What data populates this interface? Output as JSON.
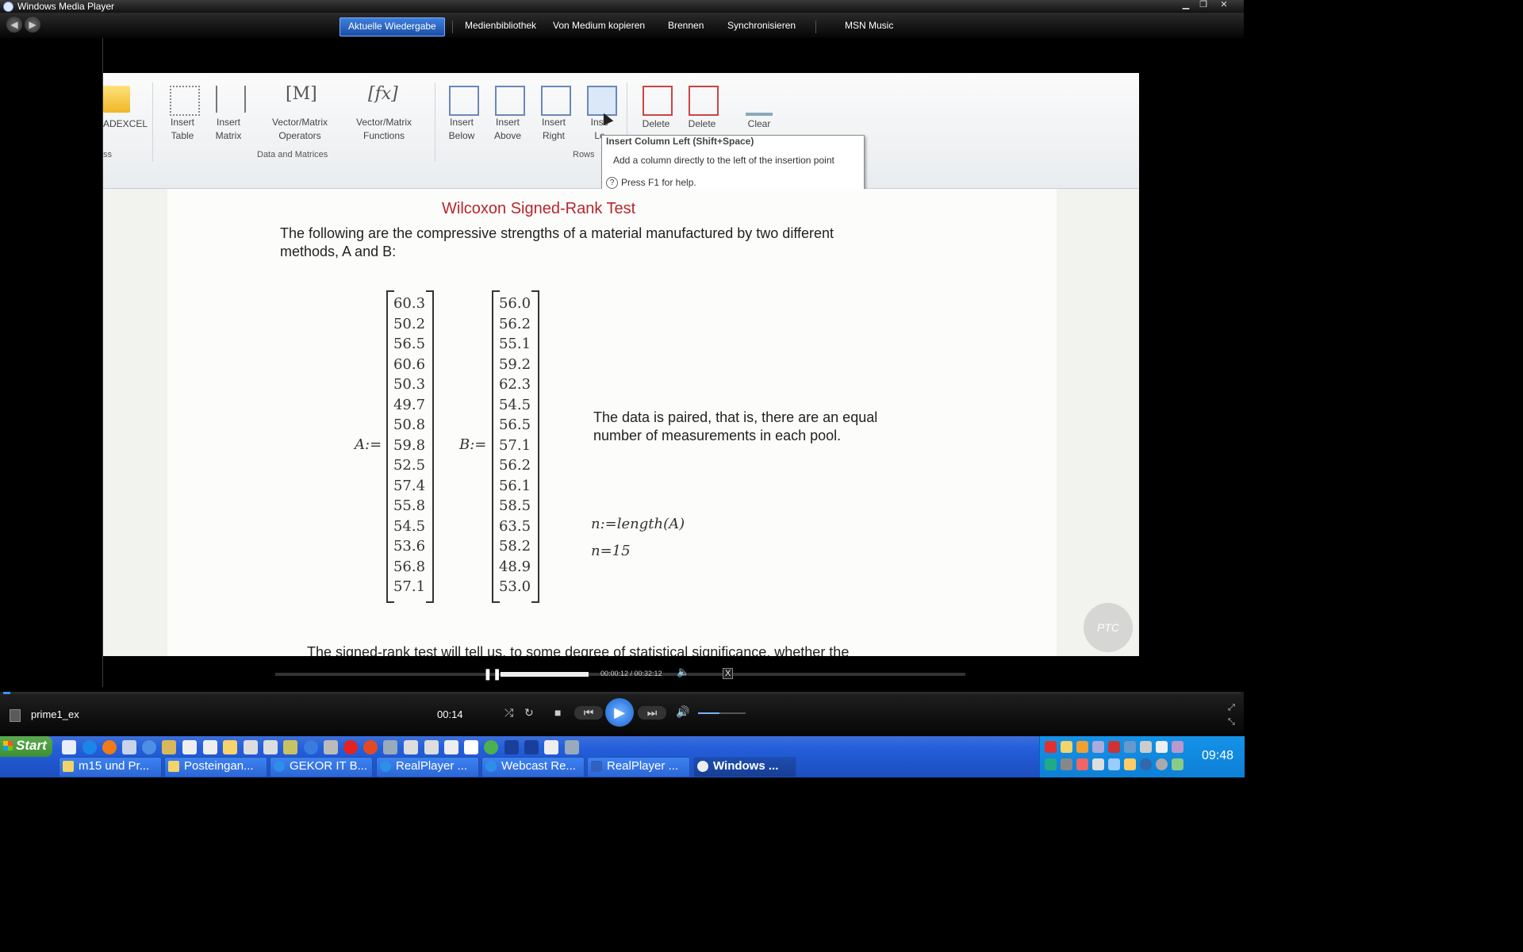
{
  "window": {
    "title": "Windows Media Player"
  },
  "nav": {
    "back": "◀",
    "forward": "▶",
    "tabs": [
      "Aktuelle Wiedergabe",
      "Medienbibliothek",
      "Von Medium kopieren",
      "Brennen",
      "Synchronisieren",
      "MSN Music"
    ]
  },
  "ribbon": {
    "addexcel": "ADEXCEL",
    "insert_table": [
      "Insert",
      "Table"
    ],
    "insert_matrix": [
      "Insert",
      "Matrix"
    ],
    "vm_operators": [
      "Vector/Matrix",
      "Operators"
    ],
    "vm_functions": [
      "Vector/Matrix",
      "Functions"
    ],
    "insert_below": [
      "Insert",
      "Below"
    ],
    "insert_above": [
      "Insert",
      "Above"
    ],
    "insert_right": [
      "Insert",
      "Right"
    ],
    "insert_left": [
      "Inse",
      "Le"
    ],
    "delete1": "Delete",
    "delete2": "Delete",
    "clear": "Clear",
    "group_left": "ss",
    "group_data": "Data and Matrices",
    "group_rows": "Rows"
  },
  "tooltip": {
    "title": "Insert Column Left (Shift+Space)",
    "desc": "Add a column directly to the left of the insertion point",
    "help": "Press F1 for help."
  },
  "doc": {
    "heading": "Wilcoxon Signed-Rank Test",
    "intro_line1": "The following are the compressive strengths of a material manufactured by two different",
    "intro_line2": "methods, A and B:",
    "label_a": "A:=",
    "label_b": "B:=",
    "values_a": [
      "60.3",
      "50.2",
      "56.5",
      "60.6",
      "50.3",
      "49.7",
      "50.8",
      "59.8",
      "52.5",
      "57.4",
      "55.8",
      "54.5",
      "53.6",
      "56.8",
      "57.1"
    ],
    "values_b": [
      "56.0",
      "56.2",
      "55.1",
      "59.2",
      "62.3",
      "54.5",
      "56.5",
      "57.1",
      "56.2",
      "56.1",
      "58.5",
      "63.5",
      "58.2",
      "48.9",
      "53.0"
    ],
    "paired_line1": "The data is paired, that is, there are an equal",
    "paired_line2": "number of measurements in each pool.",
    "formula_n": "n:=length(A)",
    "result_n": "n=15",
    "footer": "The signed-rank test will tell us, to some degree of statistical significance, whether the",
    "watermark": "PTC"
  },
  "overlay": {
    "time": "00:00:12 / 00:32:12"
  },
  "player": {
    "media_name": "prime1_ex",
    "elapsed": "00:14",
    "playback_progress": 0.006,
    "overlay_progress": 0.37,
    "volume_level": 0.45
  },
  "taskbar": {
    "start": "Start",
    "buttons": [
      "m15 und Pr...",
      "Posteingan...",
      "GEKOR IT B...",
      "RealPlayer ...",
      "Webcast Re...",
      "RealPlayer ...",
      "Windows ..."
    ],
    "clock": "09:48"
  },
  "colors": {
    "accent": "#2c66d6",
    "tab_active": "#3f7fdc",
    "heading_red": "#b8262e"
  }
}
